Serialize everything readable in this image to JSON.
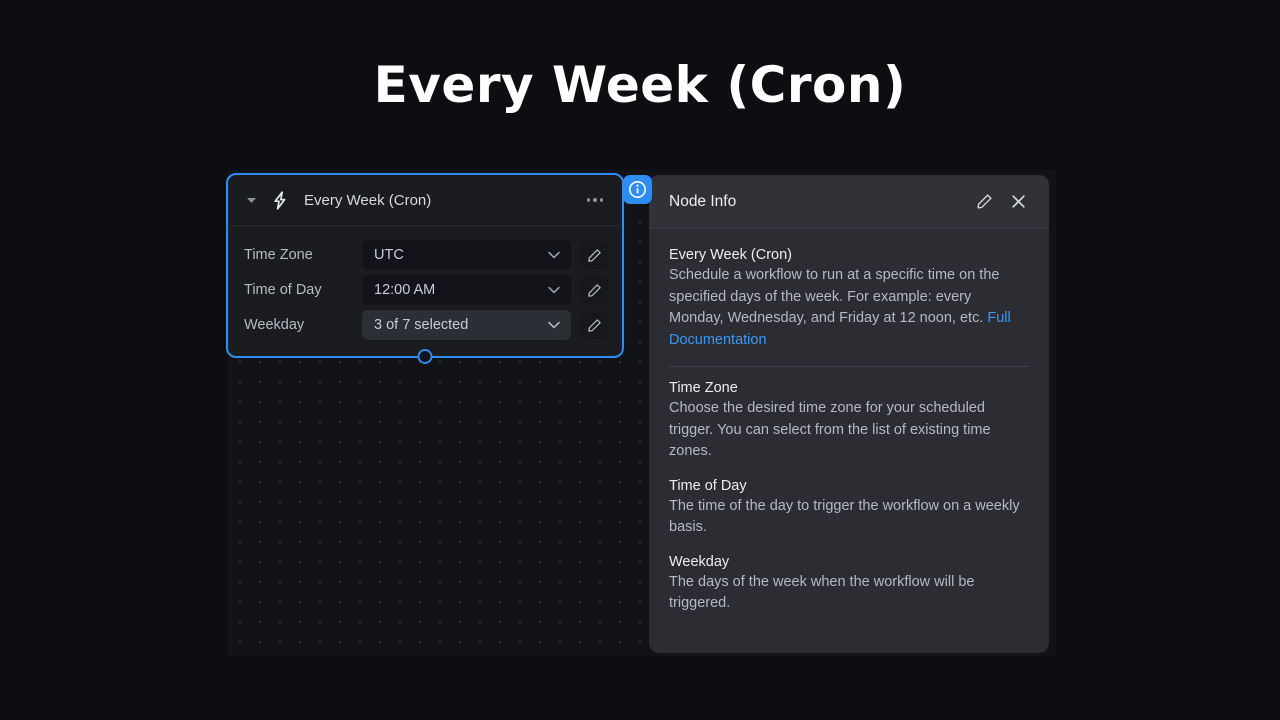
{
  "page": {
    "title": "Every Week (Cron)"
  },
  "colors": {
    "accent": "#2f8cf0",
    "link": "#3d97f2",
    "canvas_bg": "#111317",
    "node_bg": "#1a1c20",
    "panel_bg": "#2b2d32",
    "page_bg": "#0d0e11"
  },
  "node": {
    "title": "Every Week (Cron)",
    "collapse_icon": "chevron-down-icon",
    "type_icon": "lightning-bolt-icon",
    "menu_icon": "more-options-icon",
    "handle_icon": "output-handle",
    "info_badge_icon": "info-circle-icon",
    "fields": [
      {
        "label": "Time Zone",
        "value": "UTC",
        "hovered": false,
        "chevron_icon": "chevron-down-icon",
        "edit_icon": "pencil-icon"
      },
      {
        "label": "Time of Day",
        "value": "12:00 AM",
        "hovered": false,
        "chevron_icon": "chevron-down-icon",
        "edit_icon": "pencil-icon"
      },
      {
        "label": "Weekday",
        "value": "3 of 7 selected",
        "hovered": true,
        "chevron_icon": "chevron-down-icon",
        "edit_icon": "pencil-icon"
      }
    ]
  },
  "panel": {
    "title": "Node Info",
    "edit_icon": "pencil-icon",
    "close_icon": "close-icon",
    "intro": {
      "title": "Every Week (Cron)",
      "description": "Schedule a workflow to run at a specific time on the specified days of the week. For example: every Monday, Wednesday, and Friday at 12 noon, etc. ",
      "link_label": "Full Documentation"
    },
    "sections": [
      {
        "title": "Time Zone",
        "description": "Choose the desired time zone for your scheduled trigger. You can select from the list of existing time zones."
      },
      {
        "title": "Time of Day",
        "description": "The time of the day to trigger the workflow on a weekly basis."
      },
      {
        "title": "Weekday",
        "description": "The days of the week when the workflow will be triggered."
      }
    ]
  }
}
